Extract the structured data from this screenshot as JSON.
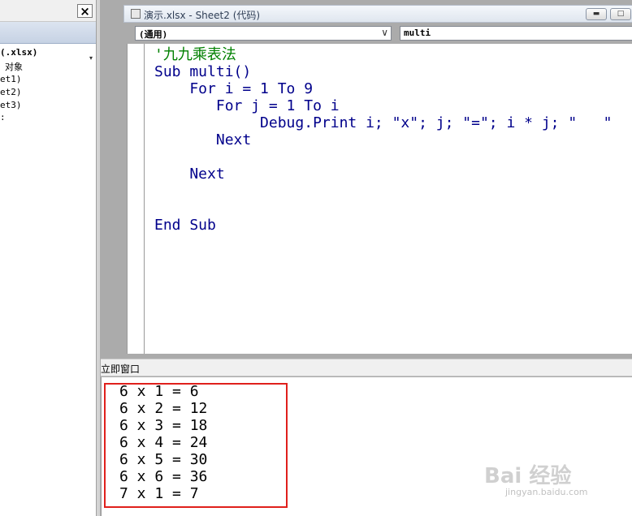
{
  "project_explorer": {
    "close_label": "×",
    "scroll_glyph": "▾",
    "items": [
      "(.xlsx)",
      "对象",
      "et1)",
      "et2)",
      "et3)",
      ":"
    ]
  },
  "code_window": {
    "title": "演示.xlsx - Sheet2 (代码)",
    "minimize_glyph": "▬",
    "maximize_glyph": "□",
    "object_dropdown": "(通用)",
    "object_dropdown_arrow": "∨",
    "procedure_dropdown": "multi",
    "code_lines": [
      "'九九乘表法",
      "Sub multi()",
      "    For i = 1 To 9",
      "       For j = 1 To i",
      "            Debug.Print i; \"x\"; j; \"=\"; i * j; \"   \"",
      "       Next",
      "    Next",
      "End Sub"
    ]
  },
  "immediate_window": {
    "title": "立即窗口",
    "lines": [
      "6 x 1 = 6",
      "6 x 2 = 12",
      "6 x 3 = 18",
      "6 x 4 = 24",
      "6 x 5 = 30",
      "6 x 6 = 36",
      "7 x 1 = 7"
    ],
    "highlight_color": "#e0201c"
  },
  "watermark": {
    "logo": "Bai 经验",
    "url": "jingyan.baidu.com"
  }
}
